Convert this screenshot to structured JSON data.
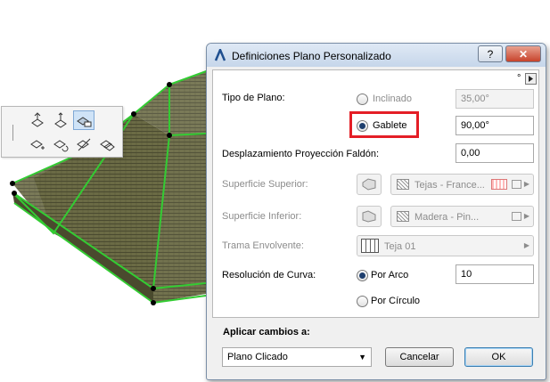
{
  "dialog": {
    "title": "Definiciones Plano Personalizado",
    "help_label": "?",
    "close_label": "✕",
    "degree_symbol": "°"
  },
  "tipo_plano": {
    "label": "Tipo de Plano:",
    "options": [
      {
        "label": "Inclinado",
        "selected": false,
        "value": "35,00°"
      },
      {
        "label": "Gablete",
        "selected": true,
        "value": "90,00°"
      }
    ]
  },
  "desplazamiento": {
    "label": "Desplazamiento Proyección Faldón:",
    "value": "0,00"
  },
  "superficie_superior": {
    "label": "Superficie Superior:",
    "value": "Tejas - France..."
  },
  "superficie_inferior": {
    "label": "Superficie Inferior:",
    "value": "Madera - Pin..."
  },
  "trama": {
    "label": "Trama Envolvente:",
    "value": "Teja 01"
  },
  "resolucion": {
    "label": "Resolución de Curva:",
    "options": [
      {
        "label": "Por Arco",
        "selected": true,
        "value": "10"
      },
      {
        "label": "Por Círculo",
        "selected": false
      }
    ]
  },
  "footer": {
    "apply_label": "Aplicar cambios a:",
    "apply_value": "Plano Clicado",
    "cancel_label": "Cancelar",
    "ok_label": "OK"
  },
  "colors": {
    "highlight": "#e41e26",
    "roof_edge": "#33cc33",
    "roof_fill": "#5a5a3a"
  }
}
